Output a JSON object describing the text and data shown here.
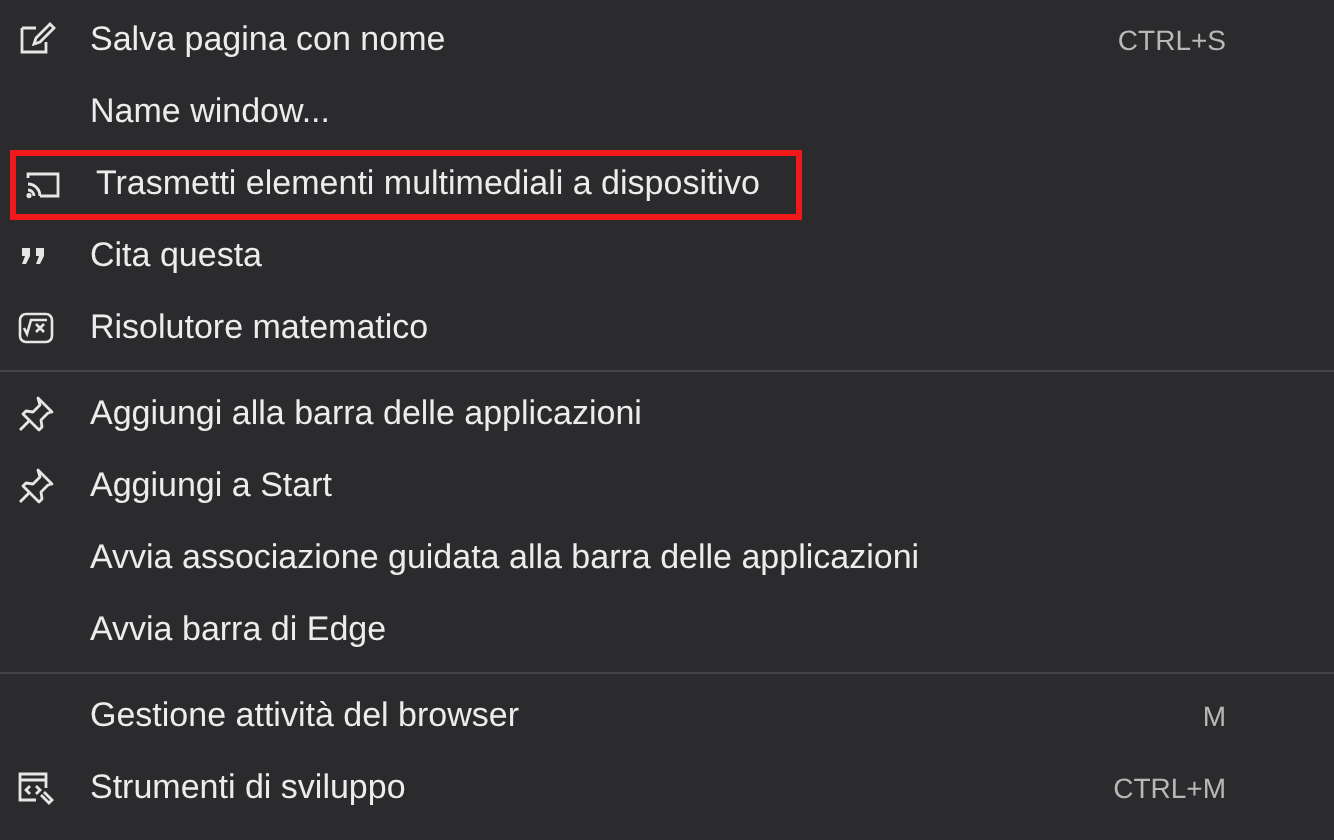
{
  "menu": {
    "items": [
      {
        "kind": "item",
        "label": "Salva pagina con nome",
        "shortcut": "CTRL+S",
        "highlighted": false
      },
      {
        "kind": "item",
        "label": "Name window...",
        "highlighted": false
      },
      {
        "kind": "item",
        "label": "Trasmetti elementi multimediali a dispositivo",
        "highlighted": true
      },
      {
        "kind": "item",
        "label": "Cita questa",
        "highlighted": false
      },
      {
        "kind": "item",
        "label": "Risolutore matematico",
        "highlighted": false
      },
      {
        "kind": "divider"
      },
      {
        "kind": "item",
        "label": "Aggiungi alla barra delle applicazioni",
        "highlighted": false
      },
      {
        "kind": "item",
        "label": "Aggiungi a Start",
        "highlighted": false
      },
      {
        "kind": "item",
        "label": "Avvia associazione guidata alla barra delle applicazioni",
        "highlighted": false
      },
      {
        "kind": "item",
        "label": "Avvia barra di Edge",
        "highlighted": false
      },
      {
        "kind": "divider"
      },
      {
        "kind": "item",
        "label": "Gestione attività del browser",
        "shortcut": "M",
        "highlighted": false
      },
      {
        "kind": "item",
        "label": "Strumenti di sviluppo",
        "shortcut": "CTRL+M",
        "highlighted": false
      }
    ]
  }
}
